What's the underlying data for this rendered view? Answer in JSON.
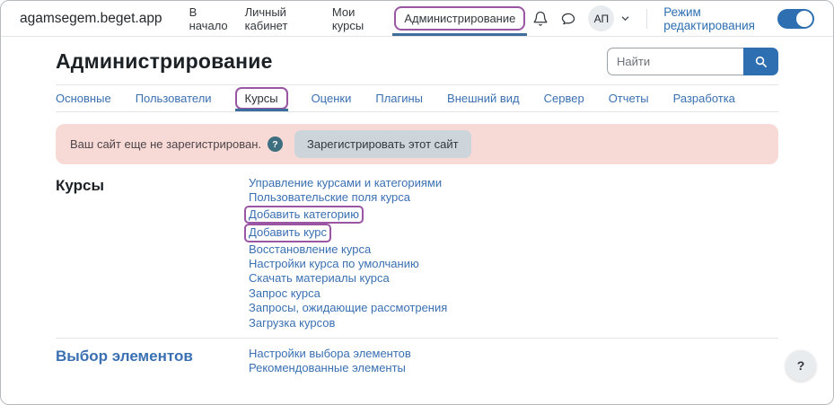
{
  "colors": {
    "accent": "#2e6fb2",
    "link": "#3a70b2",
    "underline": "#3d6e9e",
    "purple": "#9a55a3",
    "alert-bg": "#f7dad6",
    "btn-gray": "#cdd5da",
    "border": "#e2e5e8"
  },
  "navbar": {
    "brand": "agamsegem.beget.app",
    "items": [
      {
        "label": "В начало"
      },
      {
        "label": "Личный кабинет"
      },
      {
        "label": "Мои курсы"
      },
      {
        "label": "Администрирование"
      }
    ],
    "icons": {
      "bell": "notifications",
      "chat": "messages",
      "chevron": "open-user-menu"
    },
    "avatar_initials": "АП",
    "edit_mode_label": "Режим редактирования",
    "edit_mode_on": true
  },
  "header": {
    "title": "Администрирование",
    "search_placeholder": "Найти"
  },
  "tabs": [
    {
      "label": "Основные"
    },
    {
      "label": "Пользователи"
    },
    {
      "label": "Курсы"
    },
    {
      "label": "Оценки"
    },
    {
      "label": "Плагины"
    },
    {
      "label": "Внешний вид"
    },
    {
      "label": "Сервер"
    },
    {
      "label": "Отчеты"
    },
    {
      "label": "Разработка"
    }
  ],
  "active_tab": "Курсы",
  "alert": {
    "text": "Ваш сайт еще не зарегистрирован.",
    "help": "?",
    "button_label": "Зарегистрировать этот сайт"
  },
  "sections": [
    {
      "heading": "Курсы",
      "links": [
        "Управление курсами и категориями",
        "Пользовательские поля курса",
        "Добавить категорию",
        "Добавить курс",
        "Восстановление курса",
        "Настройки курса по умолчанию",
        "Скачать материалы курса",
        "Запрос курса",
        "Запросы, ожидающие рассмотрения",
        "Загрузка курсов"
      ]
    },
    {
      "heading": "Выбор элементов",
      "links": [
        "Настройки выбора элементов",
        "Рекомендованные элементы"
      ]
    }
  ],
  "help_button": "?"
}
